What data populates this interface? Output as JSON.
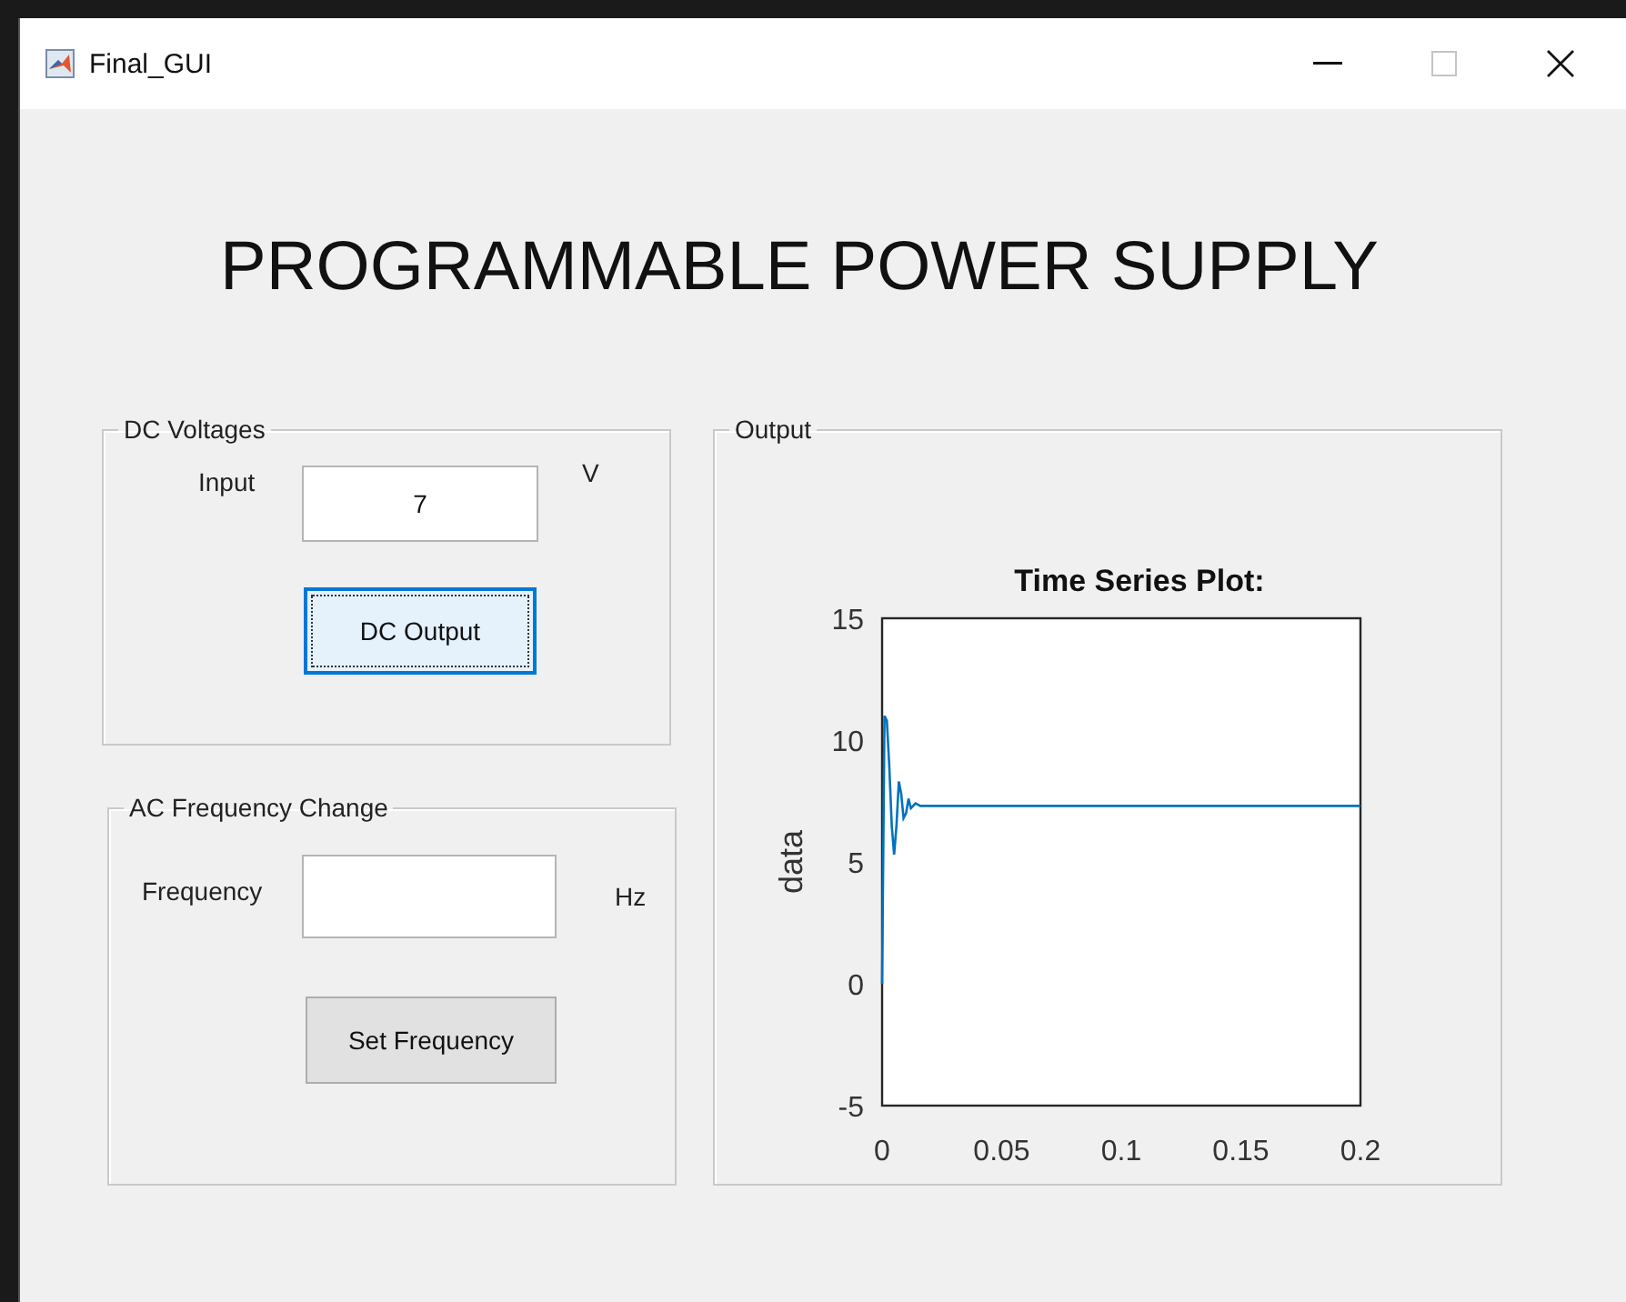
{
  "window": {
    "title": "Final_GUI",
    "maximize_disabled": true
  },
  "heading": "PROGRAMMABLE POWER SUPPLY",
  "dc_panel": {
    "title": "DC Voltages",
    "input_label": "Input",
    "input_value": "7",
    "unit": "V",
    "button": {
      "label": "DC Output",
      "focused": true
    }
  },
  "ac_panel": {
    "title": "AC Frequency Change",
    "frequency_label": "Frequency",
    "unit": "Hz",
    "button": {
      "label": "Set Frequency",
      "focused": false
    }
  },
  "output_panel": {
    "title": "Output",
    "chart_data": {
      "type": "line",
      "title": "Time Series Plot:",
      "ylabel": "data",
      "x": [
        0,
        0.001,
        0.002,
        0.003,
        0.004,
        0.005,
        0.006,
        0.007,
        0.008,
        0.009,
        0.01,
        0.011,
        0.012,
        0.014,
        0.016,
        0.02,
        0.05,
        0.1,
        0.15,
        0.2
      ],
      "series": [
        {
          "color": "#0072bd",
          "values": [
            0,
            11,
            10.8,
            9,
            6.5,
            5.3,
            6.5,
            8.3,
            7.8,
            6.8,
            7,
            7.6,
            7.2,
            7.4,
            7.3,
            7.3,
            7.3,
            7.3,
            7.3,
            7.3
          ]
        }
      ],
      "xlim": [
        0,
        0.2
      ],
      "ylim": [
        -5,
        15
      ],
      "xticks": [
        0,
        0.05,
        0.1,
        0.15,
        0.2
      ],
      "yticks": [
        -5,
        0,
        5,
        10,
        15
      ]
    }
  }
}
